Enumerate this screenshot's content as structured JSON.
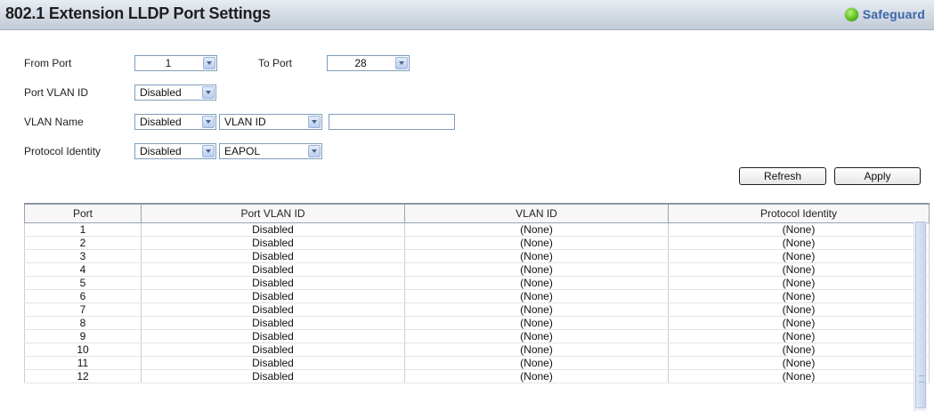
{
  "header": {
    "title": "802.1 Extension LLDP Port Settings",
    "safeguard": "Safeguard"
  },
  "form": {
    "from_port_label": "From Port",
    "from_port_value": "1",
    "to_port_label": "To Port",
    "to_port_value": "28",
    "port_vlan_id_label": "Port VLAN ID",
    "port_vlan_id_value": "Disabled",
    "vlan_name_label": "VLAN Name",
    "vlan_name_state": "Disabled",
    "vlan_name_type": "VLAN ID",
    "vlan_name_input": "",
    "protocol_identity_label": "Protocol Identity",
    "protocol_identity_state": "Disabled",
    "protocol_identity_type": "EAPOL"
  },
  "buttons": {
    "refresh": "Refresh",
    "apply": "Apply"
  },
  "table": {
    "headers": [
      "Port",
      "Port VLAN ID",
      "VLAN ID",
      "Protocol Identity"
    ],
    "rows": [
      [
        "1",
        "Disabled",
        "(None)",
        "(None)"
      ],
      [
        "2",
        "Disabled",
        "(None)",
        "(None)"
      ],
      [
        "3",
        "Disabled",
        "(None)",
        "(None)"
      ],
      [
        "4",
        "Disabled",
        "(None)",
        "(None)"
      ],
      [
        "5",
        "Disabled",
        "(None)",
        "(None)"
      ],
      [
        "6",
        "Disabled",
        "(None)",
        "(None)"
      ],
      [
        "7",
        "Disabled",
        "(None)",
        "(None)"
      ],
      [
        "8",
        "Disabled",
        "(None)",
        "(None)"
      ],
      [
        "9",
        "Disabled",
        "(None)",
        "(None)"
      ],
      [
        "10",
        "Disabled",
        "(None)",
        "(None)"
      ],
      [
        "11",
        "Disabled",
        "(None)",
        "(None)"
      ],
      [
        "12",
        "Disabled",
        "(None)",
        "(None)"
      ]
    ]
  }
}
